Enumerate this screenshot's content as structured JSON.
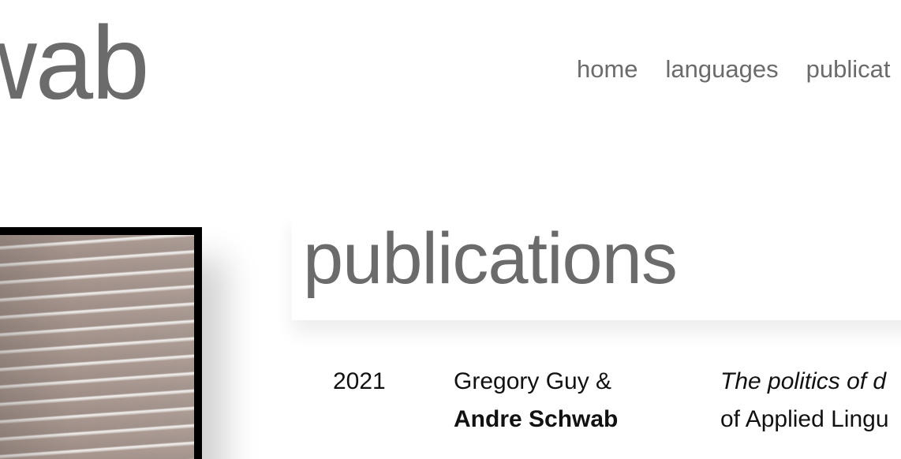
{
  "site": {
    "title_visible": "hwab"
  },
  "nav": {
    "items": [
      {
        "label": "home"
      },
      {
        "label": "languages"
      },
      {
        "label": "publicat"
      }
    ]
  },
  "main": {
    "heading": "publications",
    "publications": [
      {
        "year": "2021",
        "author_line1": "Gregory Guy &",
        "author_line2": "Andre Schwab",
        "title_line1": "The politics of d",
        "title_line2": "of Applied Lingu"
      }
    ]
  }
}
